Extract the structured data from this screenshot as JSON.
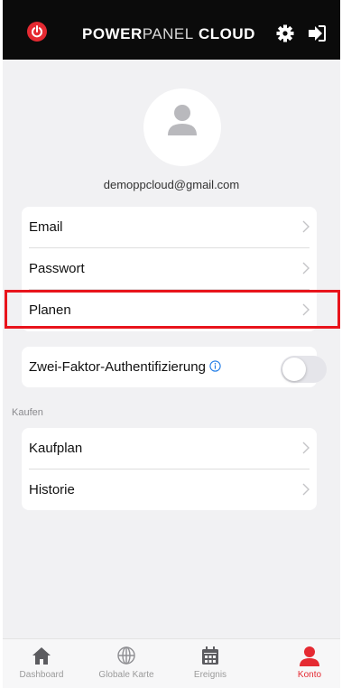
{
  "header": {
    "brand_bold_1": "POWER",
    "brand_light": "PANEL",
    "brand_bold_2": " CLOUD",
    "icons": [
      "power-logo-icon",
      "gear-icon",
      "sign-out-icon"
    ]
  },
  "profile": {
    "email": "demoppcloud@gmail.com"
  },
  "account_items": [
    {
      "label": "Email"
    },
    {
      "label": "Passwort"
    },
    {
      "label": "Planen"
    }
  ],
  "security": {
    "two_factor_label": "Zwei-Faktor-Authentifizierung",
    "two_factor_enabled": false
  },
  "purchase": {
    "section_title": "Kaufen",
    "items": [
      {
        "label": "Kaufplan"
      },
      {
        "label": "Historie"
      }
    ]
  },
  "tabs": [
    {
      "label": "Dashboard",
      "icon": "home-icon",
      "active": false
    },
    {
      "label": "Globale Karte",
      "icon": "globe-icon",
      "active": false
    },
    {
      "label": "Ereignis",
      "icon": "calendar-icon",
      "active": false
    },
    {
      "label": "Konto",
      "icon": "user-icon",
      "active": true
    }
  ],
  "colors": {
    "accent": "#e52a32",
    "header_bg": "#0b0b0b",
    "page_bg": "#f1f1f3",
    "highlight": "#e8141c"
  }
}
